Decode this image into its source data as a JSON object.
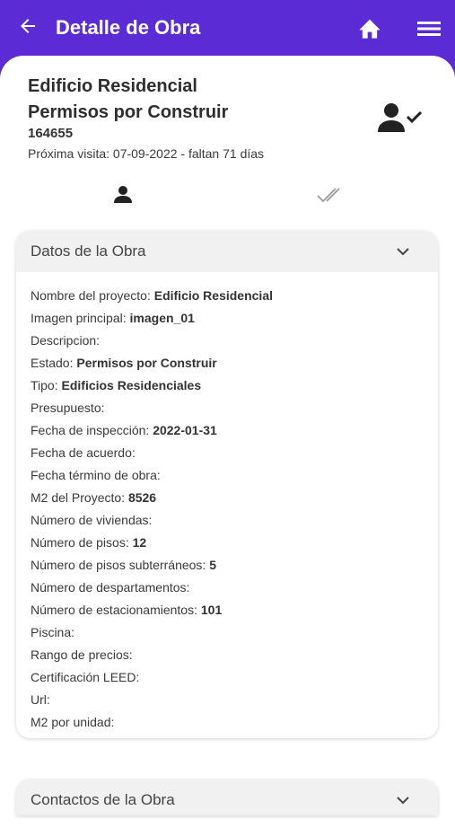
{
  "appbar": {
    "title": "Detalle de Obra"
  },
  "header": {
    "name_line1": "Edificio Residencial",
    "name_line2": "Permisos por Construir",
    "code": "164655",
    "next_visit": "Próxima visita: 07-09-2022 - faltan 71 días"
  },
  "datos": {
    "title": "Datos de la Obra",
    "fields": [
      {
        "label": "Nombre del proyecto:",
        "value": "Edificio Residencial"
      },
      {
        "label": "Imagen principal:",
        "value": "imagen_01"
      },
      {
        "label": "Descripcion:",
        "value": ""
      },
      {
        "label": "Estado:",
        "value": "Permisos por Construir"
      },
      {
        "label": "Tipo:",
        "value": "Edificios Residenciales"
      },
      {
        "label": "Presupuesto:",
        "value": ""
      },
      {
        "label": "Fecha de inspección:",
        "value": "2022-01-31"
      },
      {
        "label": "Fecha de acuerdo:",
        "value": ""
      },
      {
        "label": "Fecha término de obra:",
        "value": ""
      },
      {
        "label": "M2 del Proyecto:",
        "value": "8526"
      },
      {
        "label": "Número de viviendas:",
        "value": ""
      },
      {
        "label": "Número de pisos:",
        "value": "12"
      },
      {
        "label": "Número de pisos subterráneos:",
        "value": "5"
      },
      {
        "label": "Número de despartamentos:",
        "value": ""
      },
      {
        "label": "Número de estacionamientos:",
        "value": "101"
      },
      {
        "label": "Piscina:",
        "value": ""
      },
      {
        "label": "Rango de precios:",
        "value": ""
      },
      {
        "label": "Certificación LEED:",
        "value": ""
      },
      {
        "label": "Url:",
        "value": ""
      },
      {
        "label": "M2 por unidad:",
        "value": ""
      }
    ]
  },
  "contactos": {
    "title": "Contactos de la Obra"
  },
  "icons": {
    "back": "arrow-left-icon",
    "home": "home-icon",
    "menu": "hamburger-menu-icon",
    "assign": "user-check-icon",
    "tab_person": "person-icon",
    "tab_check": "double-check-icon",
    "chevron": "chevron-down-icon"
  },
  "colors": {
    "primary": "#5b2bd6",
    "card_header": "#f1f1f1",
    "text": "#3a3a3a"
  }
}
